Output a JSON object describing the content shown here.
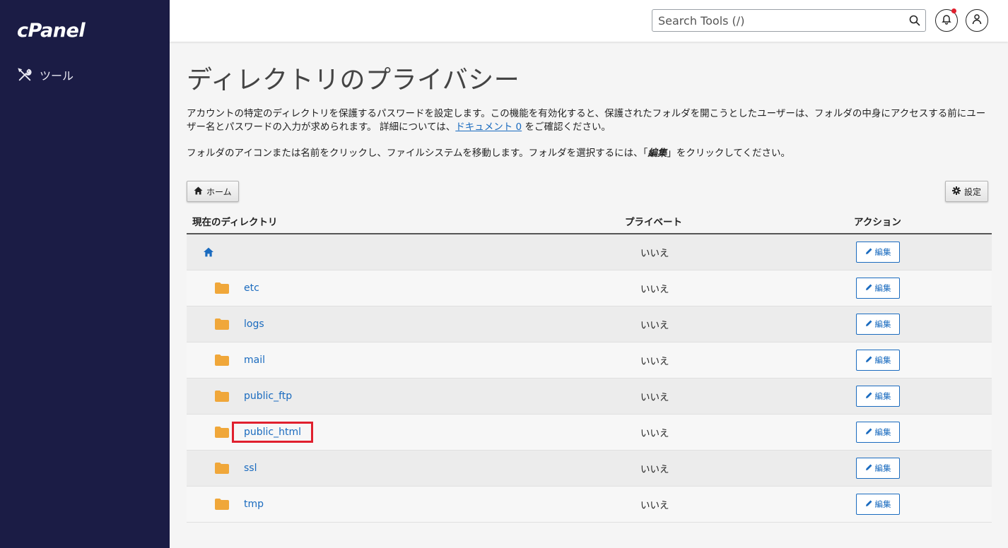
{
  "brand": {
    "logo": "cPanel"
  },
  "sidebar": {
    "items": [
      {
        "label": "ツール",
        "icon": "tools-icon"
      }
    ]
  },
  "header": {
    "search_placeholder": "Search Tools (/)",
    "notification_icon": "bell-icon",
    "user_icon": "user-icon"
  },
  "page": {
    "title": "ディレクトリのプライバシー",
    "desc_part1": "アカウントの特定のディレクトリを保護するパスワードを設定します。この機能を有効化すると、保護されたフォルダを開こうとしたユーザーは、フォルダの中身にアクセスする前にユーザー名とパスワードの入力が求められます。 詳細については、",
    "desc_link": "ドキュメント 0",
    "desc_part2": " をご確認ください。",
    "desc2_part1": "フォルダのアイコンまたは名前をクリックし、ファイルシステムを移動します。フォルダを選択するには、「",
    "desc2_em": "編集",
    "desc2_part2": "」をクリックしてください。"
  },
  "toolbar": {
    "home_label": "ホーム",
    "settings_label": "設定"
  },
  "table": {
    "headers": {
      "dir": "現在のディレクトリ",
      "private": "プライベート",
      "action": "アクション"
    },
    "home_row": {
      "private": "いいえ",
      "action": "編集"
    },
    "rows": [
      {
        "name": "etc",
        "private": "いいえ",
        "action": "編集"
      },
      {
        "name": "logs",
        "private": "いいえ",
        "action": "編集"
      },
      {
        "name": "mail",
        "private": "いいえ",
        "action": "編集"
      },
      {
        "name": "public_ftp",
        "private": "いいえ",
        "action": "編集"
      },
      {
        "name": "public_html",
        "private": "いいえ",
        "action": "編集"
      },
      {
        "name": "ssl",
        "private": "いいえ",
        "action": "編集"
      },
      {
        "name": "tmp",
        "private": "いいえ",
        "action": "編集"
      }
    ]
  },
  "colors": {
    "sidebar_bg": "#1b1c45",
    "link": "#1a6bbf",
    "folder": "#f0a73a",
    "highlight": "#e0202e"
  }
}
